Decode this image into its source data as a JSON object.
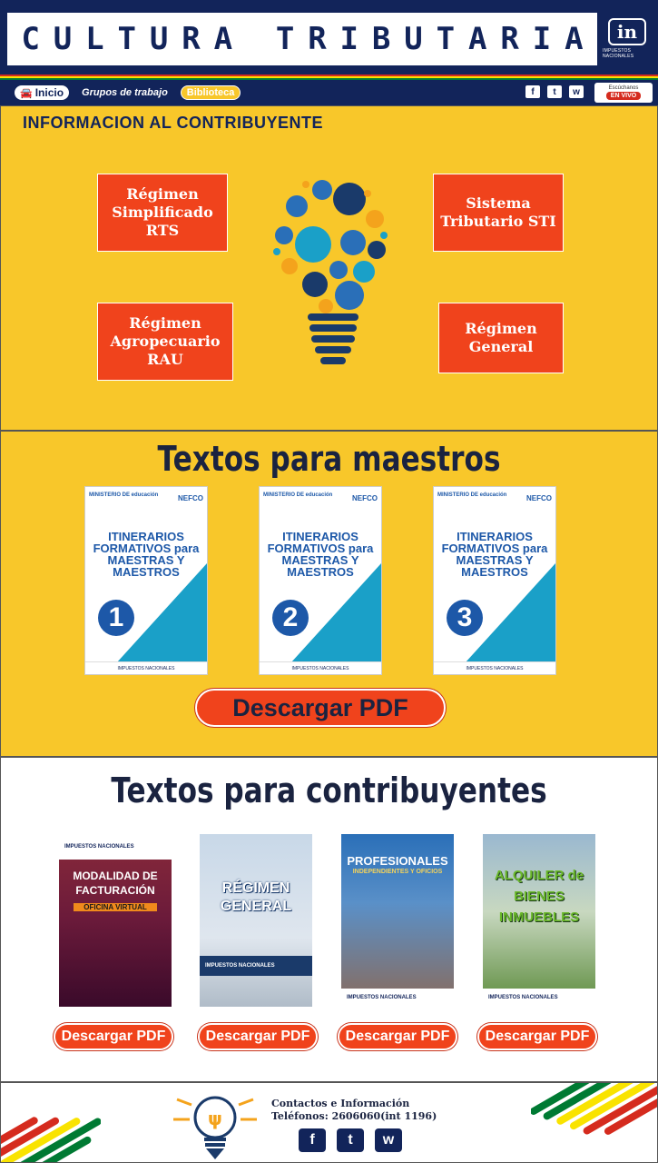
{
  "header": {
    "title_word1": [
      "C",
      "U",
      "L",
      "T",
      "U",
      "R",
      "A"
    ],
    "title_word2": [
      "T",
      "R",
      "I",
      "B",
      "U",
      "T",
      "A",
      "R",
      "I",
      "A"
    ],
    "logo_letter": "in",
    "logo_caption": "IMPUESTOS NACIONALES"
  },
  "nav": {
    "home": "Inicio",
    "groups": "Grupos de trabajo",
    "library": "Biblioteca",
    "social": [
      "f",
      "t",
      "w"
    ],
    "live_top": "Escúchanos",
    "live_badge": "EN VIVO"
  },
  "info": {
    "title": "INFORMACION AL CONTRIBUYENTE",
    "regimes": [
      "Régimen Simplificado RTS",
      "Sistema Tributario STI",
      "Régimen Agropecuario RAU",
      "Régimen General"
    ]
  },
  "teachers": {
    "title": "Textos para maestros",
    "book_title": "ITINERARIOS FORMATIVOS para MAESTRAS Y MAESTROS",
    "book_header": "MINISTERIO DE educación",
    "book_brand": "NEFCO",
    "book_footer": "IMPUESTOS NACIONALES",
    "numbers": [
      "1",
      "2",
      "3"
    ],
    "download": "Descargar PDF"
  },
  "taxpayers": {
    "title": "Textos para contribuyentes",
    "brand": "IMPUESTOS NACIONALES",
    "covers": [
      {
        "text": "MODALIDAD DE FACTURACIÓN",
        "sub": "OFICINA VIRTUAL"
      },
      {
        "text": "RÉGIMEN GENERAL",
        "sub": ""
      },
      {
        "text": "PROFESIONALES",
        "sub": "INDEPENDIENTES Y OFICIOS"
      },
      {
        "text": "ALQUILER de BIENES INMUEBLES",
        "sub": ""
      }
    ],
    "download": "Descargar PDF"
  },
  "footer": {
    "contact_title": "Contactos e Información",
    "phone": "Teléfonos: 2606060(int 1196)",
    "social": [
      "f",
      "t",
      "w"
    ]
  }
}
